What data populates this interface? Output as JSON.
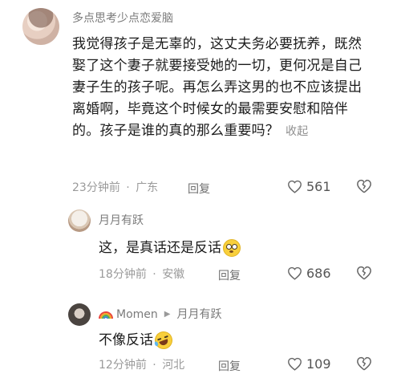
{
  "comment": {
    "username": "多点思考少点恋爱脑",
    "text": "我觉得孩子是无辜的，这丈夫务必要抚养，既然娶了这个妻子就要接受她的一切，更何况是自己妻子生的孩子呢。再怎么弄这男的也不应该提出离婚啊，毕竟这个时候女的最需要安慰和陪伴的。孩子是谁的真的那么重要吗？",
    "collapse_label": "收起",
    "time": "23分钟前",
    "location": "广东",
    "reply_label": "回复",
    "likes": "561"
  },
  "replies": [
    {
      "username": "月月有跃",
      "text": "这，是真话还是反话",
      "emoji": "flushed-face",
      "time": "18分钟前",
      "location": "安徽",
      "reply_label": "回复",
      "likes": "686"
    },
    {
      "username": "Momen",
      "reply_to": "月月有跃",
      "text": "不像反话",
      "emoji": "rolling-laughing-face",
      "time": "12分钟前",
      "location": "河北",
      "reply_label": "回复",
      "likes": "109"
    }
  ],
  "separators": {
    "dot": "·",
    "arrow": "▶"
  },
  "colors": {
    "text": "#1b1b1b",
    "meta": "#9a9a9a",
    "icon": "#6a6a6a"
  }
}
